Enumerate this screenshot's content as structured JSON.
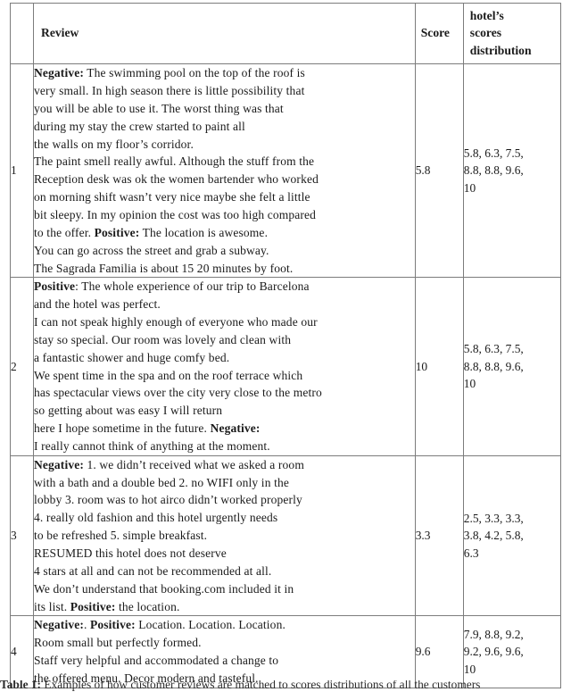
{
  "document": {
    "type": "latex-table-figure",
    "background_color": "#ffffff",
    "rule_color": "#7c7c7c",
    "text_color": "#1a1a1a"
  },
  "table": {
    "columns": [
      {
        "key": "index",
        "label": ""
      },
      {
        "key": "review",
        "label": "Review"
      },
      {
        "key": "score",
        "label": "Score"
      },
      {
        "key": "distribution",
        "label": "hotel’s scores distribution"
      }
    ],
    "header": {
      "index_label": "",
      "review_label": "Review",
      "score_label": "Score",
      "dist_label_line1": "hotel’s",
      "dist_label_line2": "scores",
      "dist_label_line3": "distribution"
    },
    "rows": [
      {
        "index": "1",
        "score": "5.8",
        "distribution_line1": "5.8, 6.3, 7.5,",
        "distribution_line2": "8.8, 8.8, 9.6,",
        "distribution_line3": "10",
        "distribution_values": [
          5.8,
          6.3,
          7.5,
          8.8,
          8.8,
          9.6,
          10
        ],
        "review_lines": [
          {
            "bold": "Negative:",
            "text": " The swimming pool on the top of the roof is"
          },
          {
            "bold": "",
            "text": "very small. In high season there is little possibility that"
          },
          {
            "bold": "",
            "text": "you will be able to use it. The worst thing was that"
          },
          {
            "bold": "",
            "text": "during my stay the crew started to paint all"
          },
          {
            "bold": "",
            "text": "the walls on my floor’s corridor."
          },
          {
            "bold": "",
            "text": "The paint smell really awful. Although the stuff from the"
          },
          {
            "bold": "",
            "text": "Reception desk was ok the women bartender who worked"
          },
          {
            "bold": "",
            "text": "on morning shift wasn’t very nice maybe she felt a little"
          },
          {
            "bold": "",
            "text": "bit sleepy. In my opinion the cost was too high compared"
          },
          {
            "bold": "",
            "text": "to the offer. ",
            "bold2": "Positive:",
            "text2": " The location is awesome."
          },
          {
            "bold": "",
            "text": "You can go across the street and grab a subway."
          },
          {
            "bold": "",
            "text": "The Sagrada Familia is about 15 20 minutes by foot."
          }
        ]
      },
      {
        "index": "2",
        "score": "10",
        "distribution_line1": "5.8, 6.3, 7.5,",
        "distribution_line2": "8.8, 8.8, 9.6,",
        "distribution_line3": "10",
        "distribution_values": [
          5.8,
          6.3,
          7.5,
          8.8,
          8.8,
          9.6,
          10
        ],
        "review_lines": [
          {
            "bold": "Positive",
            "text": ": The whole experience of our trip to Barcelona"
          },
          {
            "bold": "",
            "text": "and the hotel was perfect."
          },
          {
            "bold": "",
            "text": "I can not speak highly enough of everyone who made our"
          },
          {
            "bold": "",
            "text": "stay so special. Our room was lovely and clean with"
          },
          {
            "bold": "",
            "text": "a fantastic shower and huge comfy bed."
          },
          {
            "bold": "",
            "text": "We spent time in the spa and on the roof terrace which"
          },
          {
            "bold": "",
            "text": "has spectacular views over the city very close to the metro"
          },
          {
            "bold": "",
            "text": "so getting about was easy I will return"
          },
          {
            "bold": "",
            "text": "here I hope sometime in the future. ",
            "bold2": "Negative:",
            "text2": ""
          },
          {
            "bold": "",
            "text": "I really cannot think of anything at the moment."
          }
        ]
      },
      {
        "index": "3",
        "score": "3.3",
        "distribution_line1": "2.5, 3.3, 3.3,",
        "distribution_line2": "3.8, 4.2, 5.8,",
        "distribution_line3": "6.3",
        "distribution_values": [
          2.5,
          3.3,
          3.3,
          3.8,
          4.2,
          5.8,
          6.3
        ],
        "review_lines": [
          {
            "bold": "Negative:",
            "text": " 1. we didn’t received what we asked a room"
          },
          {
            "bold": "",
            "text": "with a bath and a double bed 2. no WIFI only in the"
          },
          {
            "bold": "",
            "text": "lobby 3. room was to hot airco didn’t worked properly"
          },
          {
            "bold": "",
            "text": "4. really old fashion and this hotel urgently needs"
          },
          {
            "bold": "",
            "text": "to be refreshed 5. simple breakfast."
          },
          {
            "bold": "",
            "text": "RESUMED this hotel does not deserve"
          },
          {
            "bold": "",
            "text": "4 stars at all and can not be recommended at all."
          },
          {
            "bold": "",
            "text": "We don’t understand that booking.com included it in"
          },
          {
            "bold": "",
            "text": "its list. ",
            "bold2": "Positive:",
            "text2": " the location."
          }
        ]
      },
      {
        "index": "4",
        "score": "9.6",
        "distribution_line1": "7.9, 8.8, 9.2,",
        "distribution_line2": "9.2, 9.6, 9.6,",
        "distribution_line3": "10",
        "distribution_values": [
          7.9,
          8.8,
          9.2,
          9.2,
          9.6,
          9.6,
          10
        ],
        "review_lines": [
          {
            "bold": "Negative:",
            "text": ". ",
            "bold2": "Positive:",
            "text2": " Location. Location. Location."
          },
          {
            "bold": "",
            "text": "Room small but perfectly formed."
          },
          {
            "bold": "",
            "text": "Staff very helpful and accommodated a change to"
          },
          {
            "bold": "",
            "text": "the offered menu. Decor modern and tasteful."
          }
        ]
      }
    ]
  },
  "caption": {
    "label": "Table 1:",
    "text": " Examples of how customer reviews are matched to scores distributions of all the customers"
  }
}
